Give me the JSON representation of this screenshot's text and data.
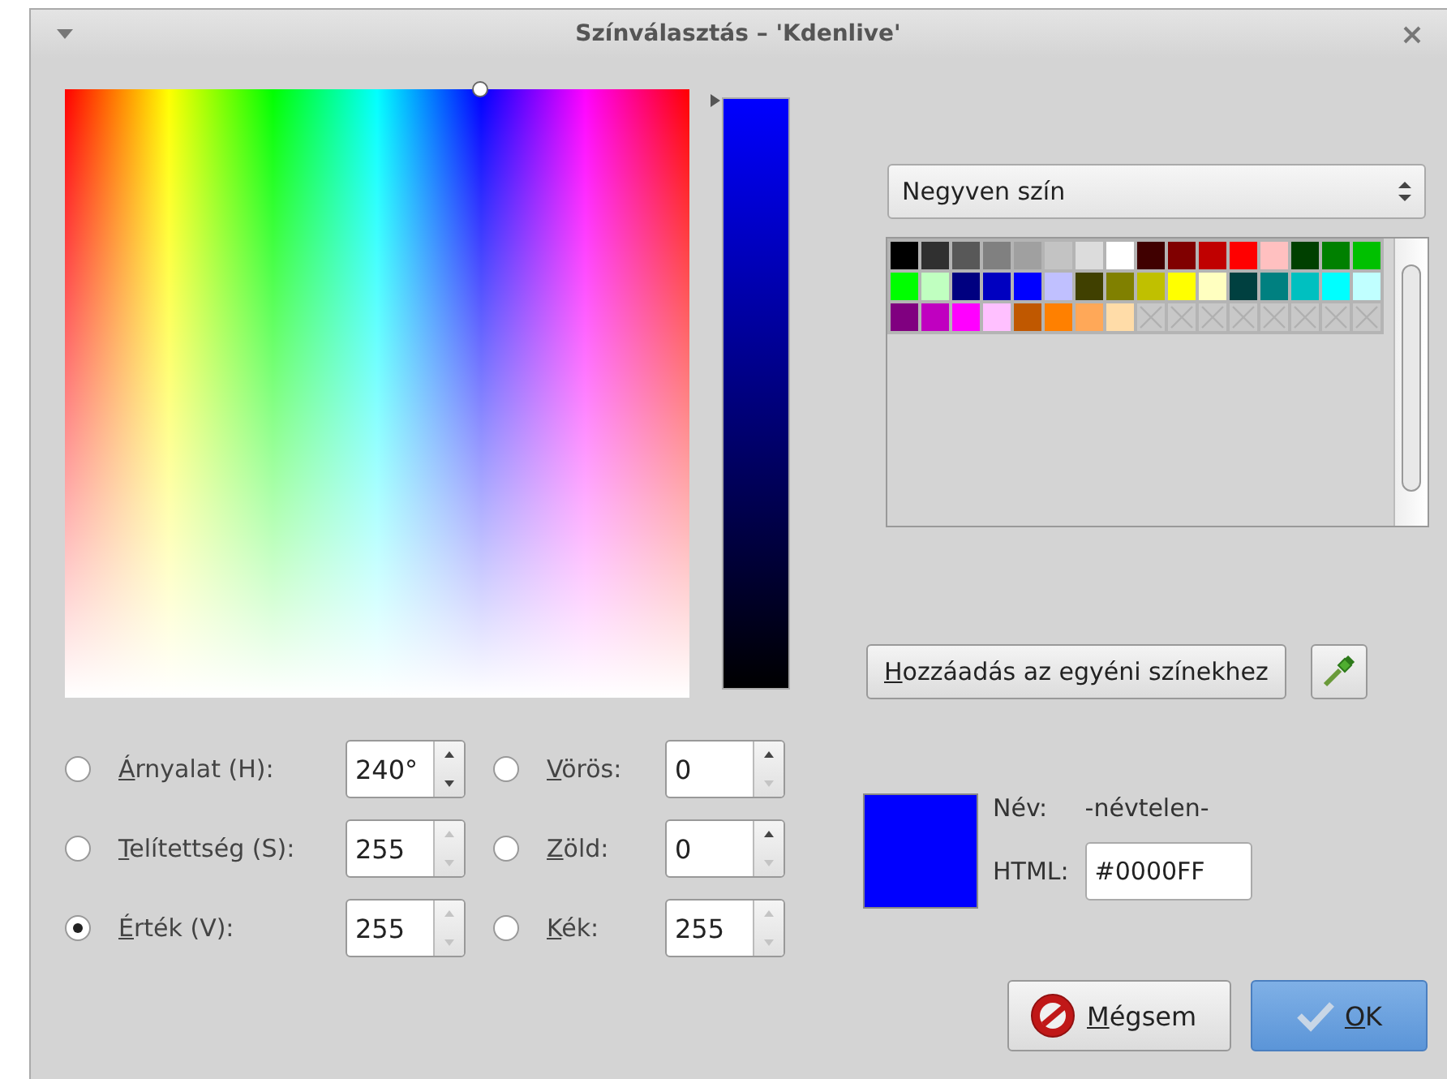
{
  "window": {
    "title": "Színválasztás – 'Kdenlive'"
  },
  "hue_saturation_picker": {
    "level": 0.667
  },
  "value_slider": {
    "level": 1
  },
  "palette_selector": {
    "value": "Negyven szín"
  },
  "swatches": [
    {
      "kind": "color",
      "color": "#000000"
    },
    {
      "kind": "color",
      "color": "#303030"
    },
    {
      "kind": "color",
      "color": "#585858"
    },
    {
      "kind": "color",
      "color": "#808080"
    },
    {
      "kind": "color",
      "color": "#a0a0a0"
    },
    {
      "kind": "color",
      "color": "#c3c3c3"
    },
    {
      "kind": "color",
      "color": "#dcdcdc"
    },
    {
      "kind": "color",
      "color": "#ffffff"
    },
    {
      "kind": "color",
      "color": "#400000"
    },
    {
      "kind": "color",
      "color": "#800000"
    },
    {
      "kind": "color",
      "color": "#c00000"
    },
    {
      "kind": "color",
      "color": "#ff0000"
    },
    {
      "kind": "color",
      "color": "#ffc0c0"
    },
    {
      "kind": "color",
      "color": "#004000"
    },
    {
      "kind": "color",
      "color": "#008000"
    },
    {
      "kind": "color",
      "color": "#00c000"
    },
    {
      "kind": "color",
      "color": "#00ff00"
    },
    {
      "kind": "color",
      "color": "#c0ffc0"
    },
    {
      "kind": "color",
      "color": "#000080"
    },
    {
      "kind": "color",
      "color": "#0000c0"
    },
    {
      "kind": "color",
      "color": "#0000ff"
    },
    {
      "kind": "color",
      "color": "#c0c0ff"
    },
    {
      "kind": "color",
      "color": "#404000"
    },
    {
      "kind": "color",
      "color": "#808000"
    },
    {
      "kind": "color",
      "color": "#c0c000"
    },
    {
      "kind": "color",
      "color": "#ffff00"
    },
    {
      "kind": "color",
      "color": "#ffffc0"
    },
    {
      "kind": "color",
      "color": "#004040"
    },
    {
      "kind": "color",
      "color": "#008080"
    },
    {
      "kind": "color",
      "color": "#00c0c0"
    },
    {
      "kind": "color",
      "color": "#00ffff"
    },
    {
      "kind": "color",
      "color": "#c0ffff"
    },
    {
      "kind": "color",
      "color": "#800080"
    },
    {
      "kind": "color",
      "color": "#c000c0"
    },
    {
      "kind": "color",
      "color": "#ff00ff"
    },
    {
      "kind": "color",
      "color": "#ffc0ff"
    },
    {
      "kind": "color",
      "color": "#c05800"
    },
    {
      "kind": "color",
      "color": "#ff8000"
    },
    {
      "kind": "color",
      "color": "#ffa858"
    },
    {
      "kind": "color",
      "color": "#ffdca8"
    },
    {
      "kind": "empty"
    },
    {
      "kind": "empty"
    },
    {
      "kind": "empty"
    },
    {
      "kind": "empty"
    },
    {
      "kind": "empty"
    },
    {
      "kind": "empty"
    },
    {
      "kind": "empty"
    },
    {
      "kind": "empty"
    }
  ],
  "add_button": "Hozzáadás az egyéni színekhez",
  "channels": [
    {
      "label": "Árnyalat (H):",
      "value": "240°",
      "selected": false,
      "up_enabled": true,
      "down_enabled": true
    },
    {
      "label": "Vörös:",
      "value": "0",
      "selected": false,
      "up_enabled": true,
      "down_enabled": false
    },
    {
      "label": "Telítettség (S):",
      "value": "255",
      "selected": false,
      "up_enabled": false,
      "down_enabled": false
    },
    {
      "label": "Zöld:",
      "value": "0",
      "selected": false,
      "up_enabled": true,
      "down_enabled": false
    },
    {
      "label": "Érték (V):",
      "value": "255",
      "selected": true,
      "up_enabled": false,
      "down_enabled": false
    },
    {
      "label": "Kék:",
      "value": "255",
      "selected": false,
      "up_enabled": false,
      "down_enabled": false
    }
  ],
  "current": {
    "color": "#0000ff",
    "name_label": "Név:",
    "name": "-névtelen-",
    "html_label": "HTML:",
    "html": "#0000FF"
  },
  "buttons": [
    {
      "kind": "cancel",
      "label": "Mégsem"
    },
    {
      "kind": "ok",
      "label": "OK"
    }
  ]
}
